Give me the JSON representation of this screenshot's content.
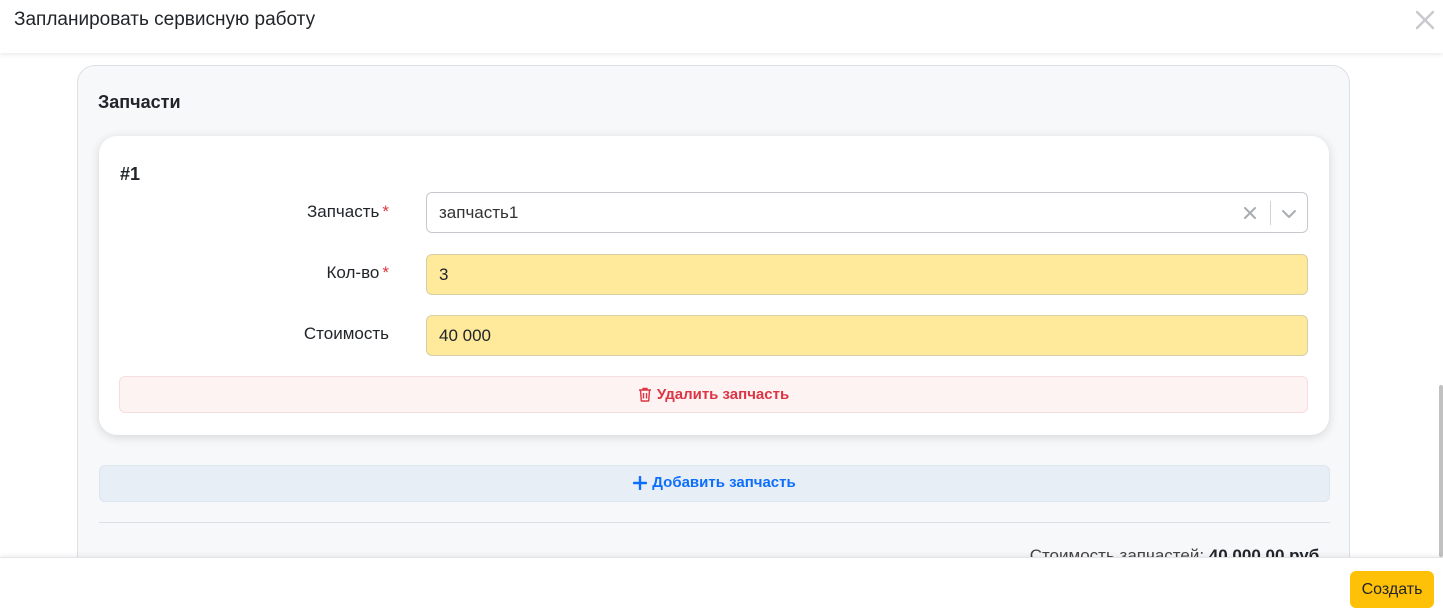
{
  "modal": {
    "title": "Запланировать сервисную работу",
    "close_icon": "close-icon"
  },
  "parts_section": {
    "title": "Запчасти",
    "items": [
      {
        "number": "#1",
        "part_label": "Запчасть",
        "part_value": "запчасть1",
        "qty_label": "Кол-во",
        "qty_value": "3",
        "cost_label": "Стоимость",
        "cost_value": "40 000",
        "required_mark": "*",
        "delete_label": "Удалить запчасть"
      }
    ],
    "add_label": "Добавить запчасть",
    "total_label": "Стоимость запчастей:",
    "total_value": "40 000,00 руб."
  },
  "footer": {
    "create_label": "Создать"
  },
  "colors": {
    "accent": "#ffc107",
    "danger": "#dc3545",
    "primary": "#0d6efd",
    "highlight_input": "#ffe99a"
  }
}
